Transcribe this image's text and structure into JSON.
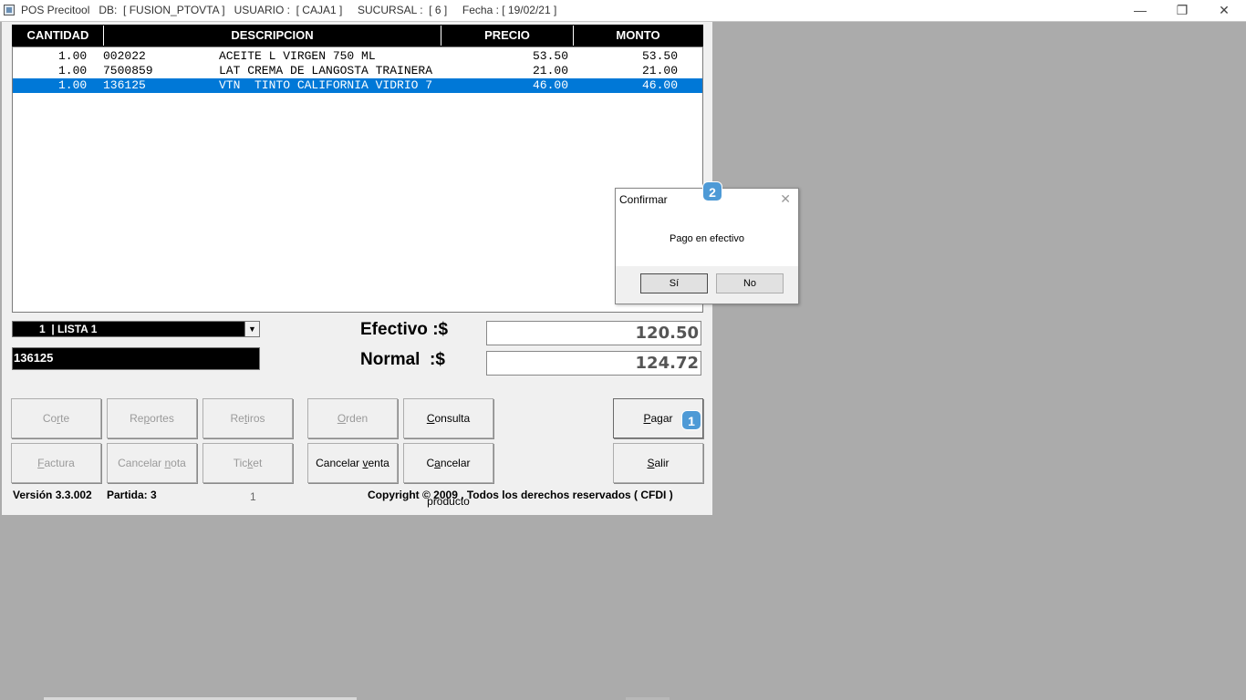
{
  "window": {
    "title": "POS Precitool   DB:  [ FUSION_PTOVTA ]   USUARIO :  [ CAJA1 ]     SUCURSAL :  [ 6 ]     Fecha : [ 19/02/21 ]",
    "minimize_icon": "minimize-icon",
    "restore_icon": "restore-icon",
    "close_icon": "close-icon"
  },
  "grid": {
    "columns": [
      "CANTIDAD",
      "DESCRIPCION",
      "PRECIO",
      "MONTO"
    ],
    "rows": [
      {
        "cantidad": "1.00",
        "codigo": "002022",
        "descripcion": "ACEITE L VIRGEN 750 ML",
        "precio": "53.50",
        "monto": "53.50",
        "selected": false
      },
      {
        "cantidad": "1.00",
        "codigo": "7500859",
        "descripcion": "LAT CREMA DE LANGOSTA TRAINERA",
        "precio": "21.00",
        "monto": "21.00",
        "selected": false
      },
      {
        "cantidad": "1.00",
        "codigo": "136125",
        "descripcion": "VTN  TINTO CALIFORNIA VIDRIO 7",
        "precio": "46.00",
        "monto": "46.00",
        "selected": true
      }
    ]
  },
  "price_list": {
    "selected": "1  | LISTA 1"
  },
  "code_input": {
    "value": "136125"
  },
  "totals": {
    "efectivo_label": "Efectivo :$",
    "efectivo_value": "120.50",
    "normal_label": "Normal  :$",
    "normal_value": "124.72"
  },
  "buttons": {
    "corte": {
      "pre": "Co",
      "u": "r",
      "post": "te"
    },
    "reportes": {
      "pre": "Re",
      "u": "p",
      "post": "ortes"
    },
    "retiros": {
      "pre": "Re",
      "u": "t",
      "post": "iros"
    },
    "orden": {
      "pre": "",
      "u": "O",
      "post": "rden"
    },
    "consulta": {
      "pre": "",
      "u": "C",
      "post": "onsulta"
    },
    "pagar": {
      "pre": "",
      "u": "P",
      "post": "agar"
    },
    "factura": {
      "pre": "",
      "u": "F",
      "post": "actura"
    },
    "cancelar_nota": {
      "pre": "Cancelar ",
      "u": "n",
      "post": "ota"
    },
    "ticket": {
      "pre": "Tic",
      "u": "k",
      "post": "et"
    },
    "cancelar_venta": {
      "pre": "Cancelar ",
      "u": "v",
      "post": "enta"
    },
    "cancelar_producto": {
      "pre": "C",
      "u": "a",
      "post": "ncelar producto"
    },
    "salir": {
      "pre": "",
      "u": "S",
      "post": "alir"
    }
  },
  "status": {
    "version": "Versión 3.3.002",
    "partida": "Partida: 3",
    "counter": "1",
    "copyright": "Copyright © 2009 . Todos los derechos reservados ( CFDI )"
  },
  "dialog": {
    "title": "Confirmar",
    "message": "Pago en efectivo",
    "yes": "Sí",
    "no": "No"
  },
  "badges": {
    "pagar": "1",
    "dialog": "2"
  },
  "colors": {
    "selection": "#0078d7",
    "header_bg": "#000000",
    "badge": "#4e9ad6",
    "desktop": "#ababab"
  }
}
